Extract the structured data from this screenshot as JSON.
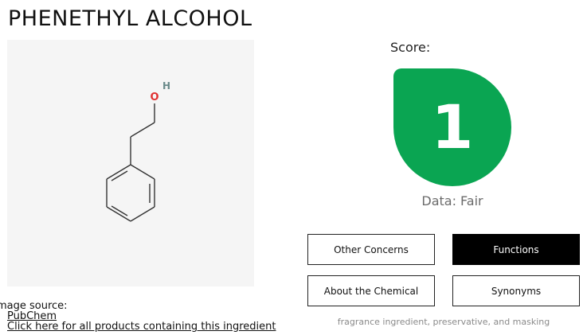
{
  "page": {
    "title": "PHENETHYL ALCOHOL"
  },
  "structure_image": {
    "atom_oxygen": "O",
    "atom_hydrogen": "H",
    "image_source_label": "mage source:",
    "image_source_link": "PubChem",
    "all_products_link": "Click here for all products containing this ingredient"
  },
  "score": {
    "label": "Score:",
    "value": "1",
    "data_label": "Data: Fair",
    "color": "#0aa552"
  },
  "tabs": [
    {
      "label": "Other Concerns",
      "active": false
    },
    {
      "label": "Functions",
      "active": true
    },
    {
      "label": "About the Chemical",
      "active": false
    },
    {
      "label": "Synonyms",
      "active": false
    }
  ],
  "functions_text": "fragrance ingredient, preservative, and masking"
}
